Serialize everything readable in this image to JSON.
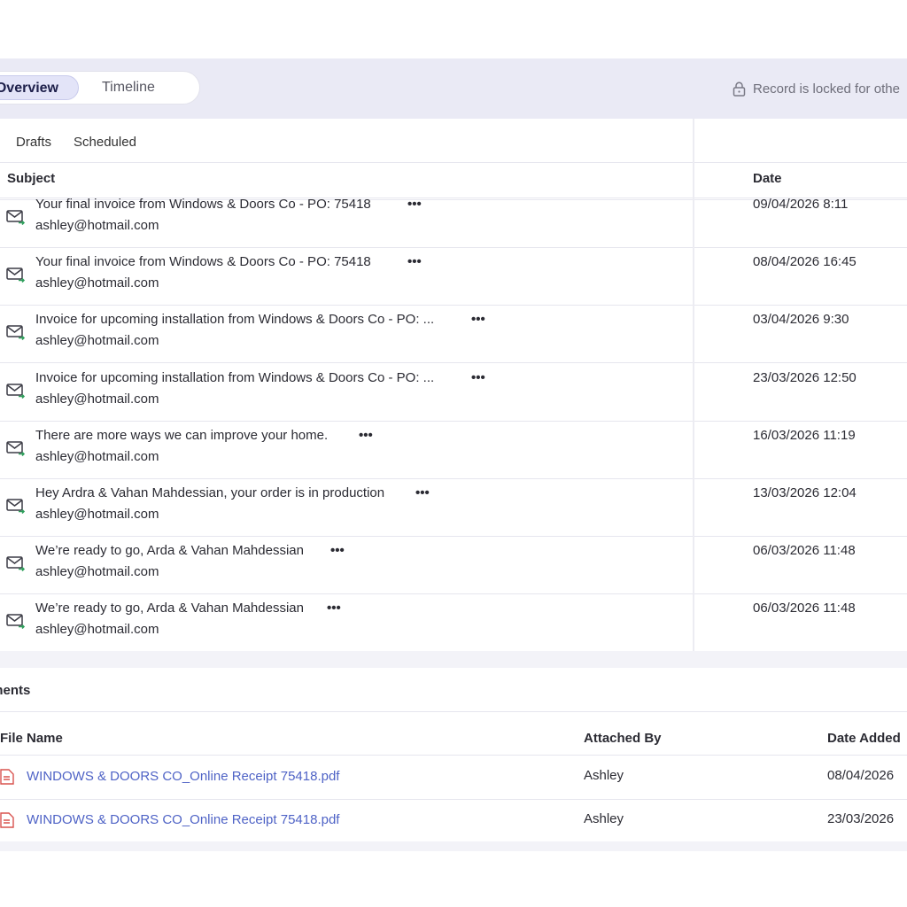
{
  "tabs": {
    "overview": "Overview",
    "timeline": "Timeline"
  },
  "lock_notice": "Record is locked for othe",
  "email_subtabs": [
    "Drafts",
    "Scheduled"
  ],
  "email_columns": {
    "subject": "Subject",
    "date": "Date"
  },
  "emails": [
    {
      "subject": "Your final invoice from  Windows & Doors Co - PO: 75418",
      "from": "ashley@hotmail.com",
      "date": "09/04/2026 8:11"
    },
    {
      "subject": "Your final invoice from  Windows & Doors Co - PO: 75418",
      "from": "ashley@hotmail.com",
      "date": "08/04/2026 16:45"
    },
    {
      "subject": "Invoice for upcoming installation from Windows & Doors Co - PO: ...",
      "from": "ashley@hotmail.com",
      "date": "03/04/2026 9:30"
    },
    {
      "subject": "Invoice for upcoming installation from Windows & Doors Co - PO: ...",
      "from": "ashley@hotmail.com",
      "date": "23/03/2026 12:50"
    },
    {
      "subject": "There are more ways we can improve  your home.",
      "from": "ashley@hotmail.com",
      "date": "16/03/2026 11:19"
    },
    {
      "subject": "Hey Ardra & Vahan Mahdessian, your order is in production",
      "from": "ashley@hotmail.com",
      "date": "13/03/2026 12:04"
    },
    {
      "subject": "We’re ready to go, Arda & Vahan Mahdessian",
      "from": "ashley@hotmail.com",
      "date": "06/03/2026 11:48"
    },
    {
      "subject": "We’re ready to go, Arda & Vahan Mahdessian",
      "from": "ashley@hotmail.com",
      "date": "06/03/2026 11:48"
    }
  ],
  "more_label": "•••",
  "attachments_title": "nments",
  "attachment_columns": {
    "file_name": "File Name",
    "attached_by": "Attached By",
    "date_added": "Date Added"
  },
  "attachments": [
    {
      "file_name": "WINDOWS & DOORS CO_Online Receipt 75418.pdf",
      "attached_by": "Ashley",
      "date_added": "08/04/2026"
    },
    {
      "file_name": "WINDOWS & DOORS CO_Online Receipt 75418.pdf",
      "attached_by": "Ashley",
      "date_added": "23/03/2026"
    }
  ],
  "colors": {
    "accent": "#4f63c6",
    "tab_active_bg": "#e3e4f8",
    "panel_bg": "#f3f3f8",
    "pdf_icon": "#d9534f",
    "mail_arrow": "#2e9e5b"
  },
  "icons": {
    "lock": "lock-icon",
    "mail": "mail-outgoing-icon",
    "pdf": "pdf-file-icon"
  }
}
